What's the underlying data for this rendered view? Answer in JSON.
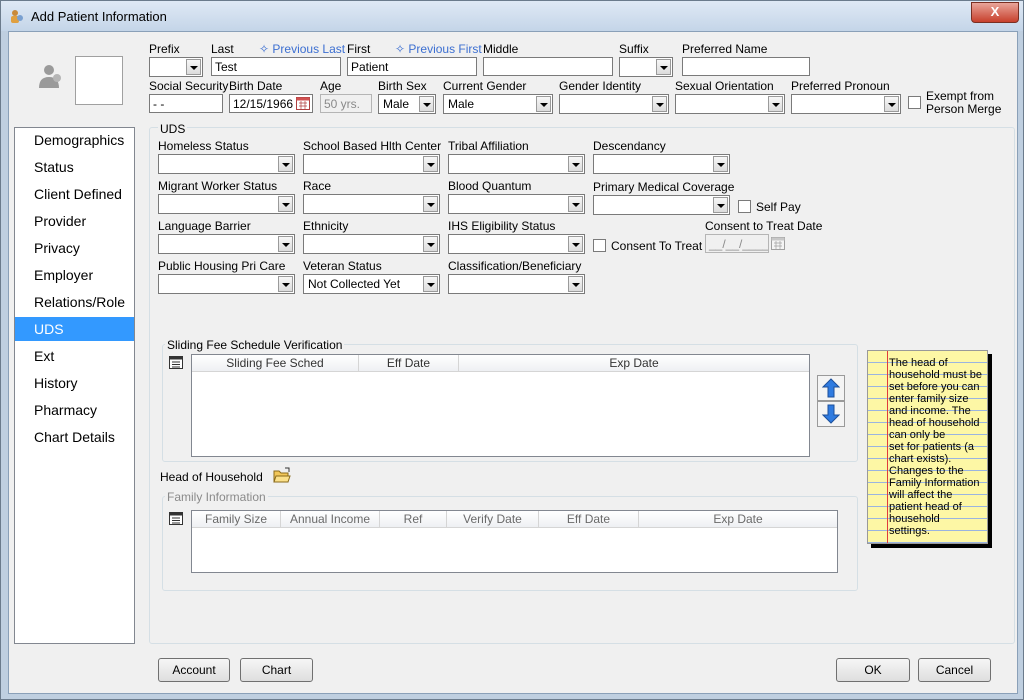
{
  "window": {
    "title": "Add Patient Information",
    "close_label": "X"
  },
  "header": {
    "prefix_label": "Prefix",
    "last_label": "Last",
    "previous_last": "Previous Last",
    "first_label": "First",
    "previous_first": "Previous First",
    "middle_label": "Middle",
    "suffix_label": "Suffix",
    "preferred_name_label": "Preferred Name",
    "last_value": "Test",
    "first_value": "Patient",
    "ssn_label": "Social Security",
    "ssn_value": " - -",
    "birth_date_label": "Birth Date",
    "birth_date_value": "12/15/1966",
    "age_label": "Age",
    "age_value": "50 yrs.",
    "birth_sex_label": "Birth Sex",
    "birth_sex_value": "Male",
    "current_gender_label": "Current Gender",
    "current_gender_value": "Male",
    "gender_identity_label": "Gender Identity",
    "sexual_orientation_label": "Sexual Orientation",
    "preferred_pronoun_label": "Preferred Pronoun",
    "exempt_label_1": "Exempt from",
    "exempt_label_2": "Person Merge"
  },
  "nav": {
    "items": [
      "Demographics",
      "Status",
      "Client Defined",
      "Provider",
      "Privacy",
      "Employer",
      "Relations/Role",
      "UDS",
      "Ext",
      "History",
      "Pharmacy",
      "Chart Details"
    ],
    "selected": "UDS"
  },
  "uds": {
    "group_label": "UDS",
    "homeless_status": "Homeless Status",
    "school_based": "School Based Hlth Center",
    "tribal_affiliation": "Tribal Affiliation",
    "descendancy": "Descendancy",
    "migrant_worker": "Migrant Worker Status",
    "race": "Race",
    "blood_quantum": "Blood Quantum",
    "primary_medical": "Primary Medical Coverage",
    "self_pay": "Self Pay",
    "language_barrier": "Language Barrier",
    "ethnicity": "Ethnicity",
    "ihs_eligibility": "IHS Eligibility Status",
    "consent_to_treat": "Consent To Treat",
    "consent_date_label": "Consent to Treat Date",
    "consent_date_value": "__/__/____",
    "public_housing": "Public Housing Pri Care",
    "veteran_status": "Veteran Status",
    "veteran_value": "Not Collected Yet",
    "classification": "Classification/Beneficiary"
  },
  "sliding": {
    "group_label": "Sliding Fee Schedule Verification",
    "columns": [
      "Sliding Fee Sched",
      "Eff Date",
      "Exp Date"
    ]
  },
  "household": {
    "label": "Head of Household",
    "family_group_label": "Family Information",
    "columns": [
      "Family Size",
      "Annual Income",
      "Ref",
      "Verify Date",
      "Eff Date",
      "Exp Date"
    ]
  },
  "note": {
    "text": "The head of\nhousehold must be\nset before you can\nenter family size\nand income.  The\nhead of household\ncan only be\nset for patients (a\nchart exists).\nChanges to the\nFamily Information\nwill affect the\npatient head of\nhousehold\nsettings."
  },
  "footer": {
    "account": "Account",
    "chart": "Chart",
    "ok": "OK",
    "cancel": "Cancel"
  }
}
